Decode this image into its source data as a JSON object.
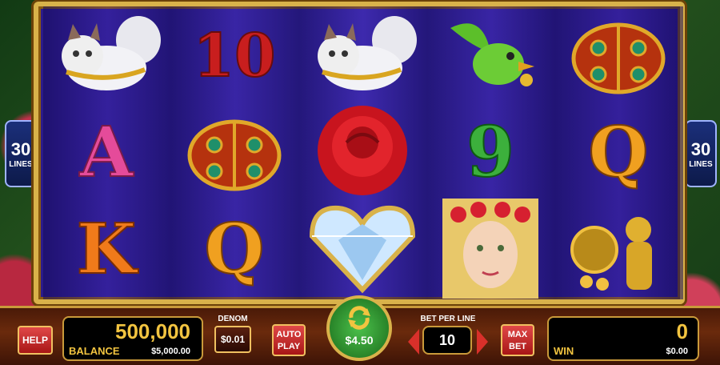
{
  "reels": [
    {
      "col": 1,
      "symbols": [
        "white-cat",
        "A",
        "K"
      ]
    },
    {
      "col": 2,
      "symbols": [
        "10",
        "ladybug",
        "Q"
      ]
    },
    {
      "col": 3,
      "symbols": [
        "white-cat",
        "red-rose",
        "diamond-heart"
      ]
    },
    {
      "col": 4,
      "symbols": [
        "green-bird",
        "9",
        "flower-lady"
      ]
    },
    {
      "col": 5,
      "symbols": [
        "ladybug",
        "Q",
        "golden-statue"
      ]
    }
  ],
  "lines_left": {
    "number": "30",
    "label": "LINES"
  },
  "lines_right": {
    "number": "30",
    "label": "LINES"
  },
  "controls": {
    "help_label": "HELP",
    "balance_credits": "500,000",
    "balance_label": "BALANCE",
    "balance_money": "$5,000.00",
    "denom_label": "DENOM",
    "denom_value": "$0.01",
    "autoplay_line1": "AUTO",
    "autoplay_line2": "PLAY",
    "spin_amount": "$4.50",
    "bet_per_line_label": "BET PER LINE",
    "bet_per_line_value": "10",
    "max_line1": "MAX",
    "max_line2": "BET",
    "win_credits": "0",
    "win_label": "WIN",
    "win_money": "$0.00"
  },
  "colors": {
    "frame_gold": "#d9b24a",
    "reel_purple": "#3a2aa8",
    "accent_red": "#c81e1e"
  }
}
